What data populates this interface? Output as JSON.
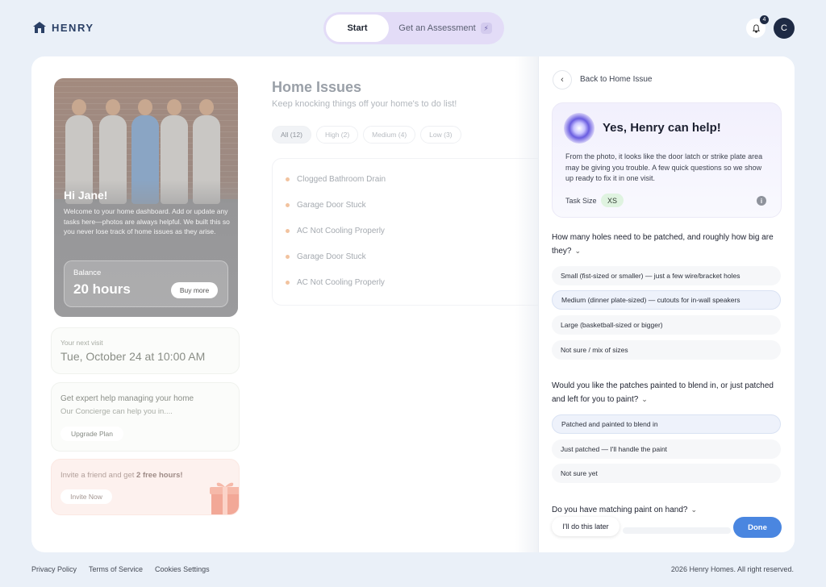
{
  "brand": {
    "name": "HENRY",
    "logo_icon": "house-icon"
  },
  "top_nav": {
    "start_label": "Start",
    "assessment_label": "Get an Assessment",
    "assessment_icon": "bolt-icon"
  },
  "header": {
    "notification_count": "4",
    "avatar_initial": "C"
  },
  "hero": {
    "greeting": "Hi Jane!",
    "message": "Welcome to your home dashboard. Add or update any tasks here—photos are always helpful. We built this so you never lose track of home issues as they arise.",
    "balance_label": "Balance",
    "balance_value": "20 hours",
    "buy_more_label": "Buy more"
  },
  "next_visit": {
    "label": "Your next visit",
    "value": "Tue, October 24 at 10:00 AM"
  },
  "concierge": {
    "title": "Get expert help managing your home",
    "text": "Our Concierge can help you in....",
    "button_label": "Upgrade Plan"
  },
  "invite": {
    "text_prefix": "Invite a friend and get ",
    "text_bold": "2 free hours!",
    "button_label": "Invite Now"
  },
  "issues": {
    "title": "Home Issues",
    "subtitle": "Keep knocking things off your home's to do list!",
    "filters": [
      {
        "label": "All (12)",
        "active": true
      },
      {
        "label": "High (2)",
        "active": false
      },
      {
        "label": "Medium (4)",
        "active": false
      },
      {
        "label": "Low (3)",
        "active": false
      }
    ],
    "items": [
      "Clogged Bathroom Drain",
      "Garage Door Stuck",
      "AC Not Cooling Properly",
      "Garage Door Stuck",
      "AC Not Cooling Properly"
    ]
  },
  "panel": {
    "back_label": "Back to Home Issue",
    "help_title": "Yes, Henry can help!",
    "help_text": "From the photo, it looks like the door latch or strike plate area may be giving you trouble. A few quick questions so we show up ready to fix it in one visit.",
    "task_size_label": "Task Size",
    "task_size_value": "XS",
    "questions": [
      {
        "text": "How many holes need to be patched, and roughly how big are they?",
        "options": [
          {
            "label": "Small (fist-sized or smaller) — just a few wire/bracket holes",
            "selected": false
          },
          {
            "label": "Medium (dinner plate-sized) — cutouts for in-wall speakers",
            "selected": true
          },
          {
            "label": "Large (basketball-sized or bigger)",
            "selected": false
          },
          {
            "label": "Not sure / mix of sizes",
            "selected": false
          }
        ]
      },
      {
        "text": "Would you like the patches painted to blend in, or just patched and left for you to paint?",
        "options": [
          {
            "label": "Patched and painted to blend in",
            "selected": true
          },
          {
            "label": "Just patched — I'll handle the paint",
            "selected": false
          },
          {
            "label": "Not sure yet",
            "selected": false
          }
        ]
      },
      {
        "text": "Do you have matching paint on hand?",
        "options": []
      }
    ],
    "later_label": "I'll do this later",
    "done_label": "Done",
    "accent_color": "#4a86e0"
  },
  "footer": {
    "links": [
      "Privacy Policy",
      "Terms of Service",
      "Cookies Settings"
    ],
    "copyright": "2026 Henry Homes. All right reserved."
  }
}
